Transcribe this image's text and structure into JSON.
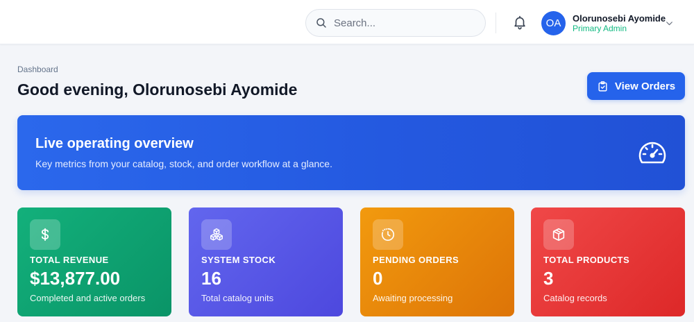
{
  "header": {
    "search_placeholder": "Search...",
    "user": {
      "initials": "OA",
      "name": "Olorunosebi Ayomide",
      "role": "Primary Admin"
    }
  },
  "page": {
    "breadcrumb": "Dashboard",
    "title": "Good evening, Olorunosebi Ayomide",
    "action_label": "View Orders"
  },
  "banner": {
    "title": "Live operating overview",
    "subtitle": "Key metrics from your catalog, stock, and order workflow at a glance.",
    "icon": "gauge-icon"
  },
  "cards": [
    {
      "label": "TOTAL REVENUE",
      "value": "$13,877.00",
      "note": "Completed and active orders",
      "icon": "dollar-icon",
      "color": "#10a873"
    },
    {
      "label": "SYSTEM STOCK",
      "value": "16",
      "note": "Total catalog units",
      "icon": "cubes-icon",
      "color": "#5a5ce8"
    },
    {
      "label": "PENDING ORDERS",
      "value": "0",
      "note": "Awaiting processing",
      "icon": "clock-icon",
      "color": "#ea870b"
    },
    {
      "label": "TOTAL PRODUCTS",
      "value": "3",
      "note": "Catalog records",
      "icon": "box-icon",
      "color": "#e83838"
    }
  ]
}
